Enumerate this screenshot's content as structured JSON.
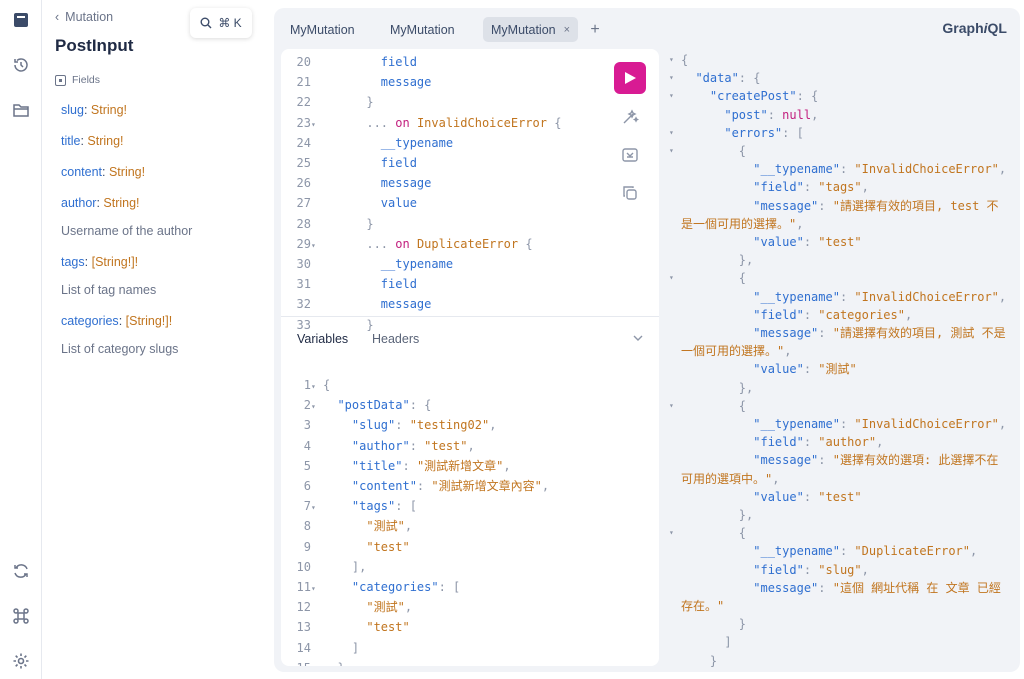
{
  "docs": {
    "back_label": "Mutation",
    "title": "PostInput",
    "fields_heading": "Fields",
    "fields": [
      {
        "name": "slug",
        "type": "String!",
        "description": ""
      },
      {
        "name": "title",
        "type": "String!",
        "description": ""
      },
      {
        "name": "content",
        "type": "String!",
        "description": ""
      },
      {
        "name": "author",
        "type": "String!",
        "description": "Username of the author"
      },
      {
        "name": "tags",
        "type": "[String!]!",
        "description": "List of tag names"
      },
      {
        "name": "categories",
        "type": "[String!]!",
        "description": "List of category slugs"
      }
    ]
  },
  "search": {
    "shortcut": "⌘ K"
  },
  "tabs": [
    {
      "label": "MyMutation",
      "active": false
    },
    {
      "label": "MyMutation",
      "active": false
    },
    {
      "label": "MyMutation",
      "active": true,
      "close": "×"
    }
  ],
  "add_tab": "+",
  "brand": {
    "text": "Graph",
    "italic": "i",
    "suffix": "QL"
  },
  "query_lines": [
    {
      "n": "20",
      "fold": "",
      "parts": [
        {
          "t": "        field",
          "c": "fld"
        }
      ]
    },
    {
      "n": "21",
      "fold": "",
      "parts": [
        {
          "t": "        message",
          "c": "fld"
        }
      ]
    },
    {
      "n": "22",
      "fold": "",
      "parts": [
        {
          "t": "      }",
          "c": "pn"
        }
      ]
    },
    {
      "n": "23",
      "fold": "▾",
      "parts": [
        {
          "t": "      ... ",
          "c": "pn"
        },
        {
          "t": "on ",
          "c": "kw"
        },
        {
          "t": "InvalidChoiceError",
          "c": "tp"
        },
        {
          "t": " {",
          "c": "pn"
        }
      ]
    },
    {
      "n": "24",
      "fold": "",
      "parts": [
        {
          "t": "        __typename",
          "c": "fld"
        }
      ]
    },
    {
      "n": "25",
      "fold": "",
      "parts": [
        {
          "t": "        field",
          "c": "fld"
        }
      ]
    },
    {
      "n": "26",
      "fold": "",
      "parts": [
        {
          "t": "        message",
          "c": "fld"
        }
      ]
    },
    {
      "n": "27",
      "fold": "",
      "parts": [
        {
          "t": "        value",
          "c": "fld"
        }
      ]
    },
    {
      "n": "28",
      "fold": "",
      "parts": [
        {
          "t": "      }",
          "c": "pn"
        }
      ]
    },
    {
      "n": "29",
      "fold": "▾",
      "parts": [
        {
          "t": "      ... ",
          "c": "pn"
        },
        {
          "t": "on ",
          "c": "kw"
        },
        {
          "t": "DuplicateError",
          "c": "tp"
        },
        {
          "t": " {",
          "c": "pn"
        }
      ]
    },
    {
      "n": "30",
      "fold": "",
      "parts": [
        {
          "t": "        __typename",
          "c": "fld"
        }
      ]
    },
    {
      "n": "31",
      "fold": "",
      "parts": [
        {
          "t": "        field",
          "c": "fld"
        }
      ]
    },
    {
      "n": "32",
      "fold": "",
      "parts": [
        {
          "t": "        message",
          "c": "fld"
        }
      ]
    },
    {
      "n": "33",
      "fold": "",
      "parts": [
        {
          "t": "      }",
          "c": "pn"
        }
      ]
    }
  ],
  "variables_tab": "Variables",
  "headers_tab": "Headers",
  "variables_lines": [
    {
      "n": "1",
      "fold": "▾",
      "parts": [
        {
          "t": "{",
          "c": "pn"
        }
      ]
    },
    {
      "n": "2",
      "fold": "▾",
      "parts": [
        {
          "t": "  \"postData\"",
          "c": "key"
        },
        {
          "t": ": {",
          "c": "pn"
        }
      ]
    },
    {
      "n": "3",
      "fold": "",
      "parts": [
        {
          "t": "    \"slug\"",
          "c": "key"
        },
        {
          "t": ": ",
          "c": "pn"
        },
        {
          "t": "\"testing02\"",
          "c": "str"
        },
        {
          "t": ",",
          "c": "pn"
        }
      ]
    },
    {
      "n": "4",
      "fold": "",
      "parts": [
        {
          "t": "    \"author\"",
          "c": "key"
        },
        {
          "t": ": ",
          "c": "pn"
        },
        {
          "t": "\"test\"",
          "c": "str"
        },
        {
          "t": ",",
          "c": "pn"
        }
      ]
    },
    {
      "n": "5",
      "fold": "",
      "parts": [
        {
          "t": "    \"title\"",
          "c": "key"
        },
        {
          "t": ": ",
          "c": "pn"
        },
        {
          "t": "\"測試新增文章\"",
          "c": "str"
        },
        {
          "t": ",",
          "c": "pn"
        }
      ]
    },
    {
      "n": "6",
      "fold": "",
      "parts": [
        {
          "t": "    \"content\"",
          "c": "key"
        },
        {
          "t": ": ",
          "c": "pn"
        },
        {
          "t": "\"測試新增文章內容\"",
          "c": "str"
        },
        {
          "t": ",",
          "c": "pn"
        }
      ]
    },
    {
      "n": "7",
      "fold": "▾",
      "parts": [
        {
          "t": "    \"tags\"",
          "c": "key"
        },
        {
          "t": ": [",
          "c": "pn"
        }
      ]
    },
    {
      "n": "8",
      "fold": "",
      "parts": [
        {
          "t": "      \"測試\"",
          "c": "str"
        },
        {
          "t": ",",
          "c": "pn"
        }
      ]
    },
    {
      "n": "9",
      "fold": "",
      "parts": [
        {
          "t": "      \"test\"",
          "c": "str"
        }
      ]
    },
    {
      "n": "10",
      "fold": "",
      "parts": [
        {
          "t": "    ],",
          "c": "pn"
        }
      ]
    },
    {
      "n": "11",
      "fold": "▾",
      "parts": [
        {
          "t": "    \"categories\"",
          "c": "key"
        },
        {
          "t": ": [",
          "c": "pn"
        }
      ]
    },
    {
      "n": "12",
      "fold": "",
      "parts": [
        {
          "t": "      \"測試\"",
          "c": "str"
        },
        {
          "t": ",",
          "c": "pn"
        }
      ]
    },
    {
      "n": "13",
      "fold": "",
      "parts": [
        {
          "t": "      \"test\"",
          "c": "str"
        }
      ]
    },
    {
      "n": "14",
      "fold": "",
      "parts": [
        {
          "t": "    ]",
          "c": "pn"
        }
      ]
    },
    {
      "n": "15",
      "fold": "",
      "parts": [
        {
          "t": "  }",
          "c": "pn"
        }
      ]
    }
  ],
  "result_lines": [
    {
      "fold": "▾",
      "parts": [
        {
          "t": "{",
          "c": "pn"
        }
      ]
    },
    {
      "fold": "▾",
      "parts": [
        {
          "t": "  \"data\"",
          "c": "key"
        },
        {
          "t": ": {",
          "c": "pn"
        }
      ]
    },
    {
      "fold": "▾",
      "parts": [
        {
          "t": "    \"createPost\"",
          "c": "key"
        },
        {
          "t": ": {",
          "c": "pn"
        }
      ]
    },
    {
      "fold": "",
      "parts": [
        {
          "t": "      \"post\"",
          "c": "key"
        },
        {
          "t": ": ",
          "c": "pn"
        },
        {
          "t": "null",
          "c": "kw"
        },
        {
          "t": ",",
          "c": "pn"
        }
      ]
    },
    {
      "fold": "▾",
      "parts": [
        {
          "t": "      \"errors\"",
          "c": "key"
        },
        {
          "t": ": [",
          "c": "pn"
        }
      ]
    },
    {
      "fold": "▾",
      "parts": [
        {
          "t": "        {",
          "c": "pn"
        }
      ]
    },
    {
      "fold": "",
      "parts": [
        {
          "t": "          \"__typename\"",
          "c": "key"
        },
        {
          "t": ": ",
          "c": "pn"
        },
        {
          "t": "\"InvalidChoiceError\"",
          "c": "str"
        },
        {
          "t": ",",
          "c": "pn"
        }
      ]
    },
    {
      "fold": "",
      "parts": [
        {
          "t": "          \"field\"",
          "c": "key"
        },
        {
          "t": ": ",
          "c": "pn"
        },
        {
          "t": "\"tags\"",
          "c": "str"
        },
        {
          "t": ",",
          "c": "pn"
        }
      ]
    },
    {
      "fold": "",
      "parts": [
        {
          "t": "          \"message\"",
          "c": "key"
        },
        {
          "t": ": ",
          "c": "pn"
        },
        {
          "t": "\"請選擇有效的項目, test 不",
          "c": "str"
        }
      ]
    },
    {
      "fold": "",
      "parts": [
        {
          "t": "是一個可用的選擇。\"",
          "c": "str"
        },
        {
          "t": ",",
          "c": "pn"
        }
      ]
    },
    {
      "fold": "",
      "parts": [
        {
          "t": "          \"value\"",
          "c": "key"
        },
        {
          "t": ": ",
          "c": "pn"
        },
        {
          "t": "\"test\"",
          "c": "str"
        }
      ]
    },
    {
      "fold": "",
      "parts": [
        {
          "t": "        },",
          "c": "pn"
        }
      ]
    },
    {
      "fold": "▾",
      "parts": [
        {
          "t": "        {",
          "c": "pn"
        }
      ]
    },
    {
      "fold": "",
      "parts": [
        {
          "t": "          \"__typename\"",
          "c": "key"
        },
        {
          "t": ": ",
          "c": "pn"
        },
        {
          "t": "\"InvalidChoiceError\"",
          "c": "str"
        },
        {
          "t": ",",
          "c": "pn"
        }
      ]
    },
    {
      "fold": "",
      "parts": [
        {
          "t": "          \"field\"",
          "c": "key"
        },
        {
          "t": ": ",
          "c": "pn"
        },
        {
          "t": "\"categories\"",
          "c": "str"
        },
        {
          "t": ",",
          "c": "pn"
        }
      ]
    },
    {
      "fold": "",
      "parts": [
        {
          "t": "          \"message\"",
          "c": "key"
        },
        {
          "t": ": ",
          "c": "pn"
        },
        {
          "t": "\"請選擇有效的項目, 測試 不是",
          "c": "str"
        }
      ]
    },
    {
      "fold": "",
      "parts": [
        {
          "t": "一個可用的選擇。\"",
          "c": "str"
        },
        {
          "t": ",",
          "c": "pn"
        }
      ]
    },
    {
      "fold": "",
      "parts": [
        {
          "t": "          \"value\"",
          "c": "key"
        },
        {
          "t": ": ",
          "c": "pn"
        },
        {
          "t": "\"測試\"",
          "c": "str"
        }
      ]
    },
    {
      "fold": "",
      "parts": [
        {
          "t": "        },",
          "c": "pn"
        }
      ]
    },
    {
      "fold": "▾",
      "parts": [
        {
          "t": "        {",
          "c": "pn"
        }
      ]
    },
    {
      "fold": "",
      "parts": [
        {
          "t": "          \"__typename\"",
          "c": "key"
        },
        {
          "t": ": ",
          "c": "pn"
        },
        {
          "t": "\"InvalidChoiceError\"",
          "c": "str"
        },
        {
          "t": ",",
          "c": "pn"
        }
      ]
    },
    {
      "fold": "",
      "parts": [
        {
          "t": "          \"field\"",
          "c": "key"
        },
        {
          "t": ": ",
          "c": "pn"
        },
        {
          "t": "\"author\"",
          "c": "str"
        },
        {
          "t": ",",
          "c": "pn"
        }
      ]
    },
    {
      "fold": "",
      "parts": [
        {
          "t": "          \"message\"",
          "c": "key"
        },
        {
          "t": ": ",
          "c": "pn"
        },
        {
          "t": "\"選擇有效的選項: 此選擇不在",
          "c": "str"
        }
      ]
    },
    {
      "fold": "",
      "parts": [
        {
          "t": "可用的選項中。\"",
          "c": "str"
        },
        {
          "t": ",",
          "c": "pn"
        }
      ]
    },
    {
      "fold": "",
      "parts": [
        {
          "t": "          \"value\"",
          "c": "key"
        },
        {
          "t": ": ",
          "c": "pn"
        },
        {
          "t": "\"test\"",
          "c": "str"
        }
      ]
    },
    {
      "fold": "",
      "parts": [
        {
          "t": "        },",
          "c": "pn"
        }
      ]
    },
    {
      "fold": "▾",
      "parts": [
        {
          "t": "        {",
          "c": "pn"
        }
      ]
    },
    {
      "fold": "",
      "parts": [
        {
          "t": "          \"__typename\"",
          "c": "key"
        },
        {
          "t": ": ",
          "c": "pn"
        },
        {
          "t": "\"DuplicateError\"",
          "c": "str"
        },
        {
          "t": ",",
          "c": "pn"
        }
      ]
    },
    {
      "fold": "",
      "parts": [
        {
          "t": "          \"field\"",
          "c": "key"
        },
        {
          "t": ": ",
          "c": "pn"
        },
        {
          "t": "\"slug\"",
          "c": "str"
        },
        {
          "t": ",",
          "c": "pn"
        }
      ]
    },
    {
      "fold": "",
      "parts": [
        {
          "t": "          \"message\"",
          "c": "key"
        },
        {
          "t": ": ",
          "c": "pn"
        },
        {
          "t": "\"這個 網址代稱 在 文章 已經",
          "c": "str"
        }
      ]
    },
    {
      "fold": "",
      "parts": [
        {
          "t": "存在。\"",
          "c": "str"
        }
      ]
    },
    {
      "fold": "",
      "parts": [
        {
          "t": "        }",
          "c": "pn"
        }
      ]
    },
    {
      "fold": "",
      "parts": [
        {
          "t": "      ]",
          "c": "pn"
        }
      ]
    },
    {
      "fold": "",
      "parts": [
        {
          "t": "    }",
          "c": "pn"
        }
      ]
    }
  ],
  "icons": {
    "rail_top": [
      "docs-icon",
      "history-icon",
      "explorer-icon"
    ],
    "rail_bottom": [
      "refetch-schema-icon",
      "shortcuts-icon",
      "settings-icon"
    ],
    "tools": [
      "prettify-icon",
      "merge-fragments-icon",
      "copy-query-icon"
    ]
  },
  "colors": {
    "accent": "#d81b93",
    "keyword": "#c21f7e",
    "type": "#c1751f",
    "field": "#2f6fd0"
  }
}
